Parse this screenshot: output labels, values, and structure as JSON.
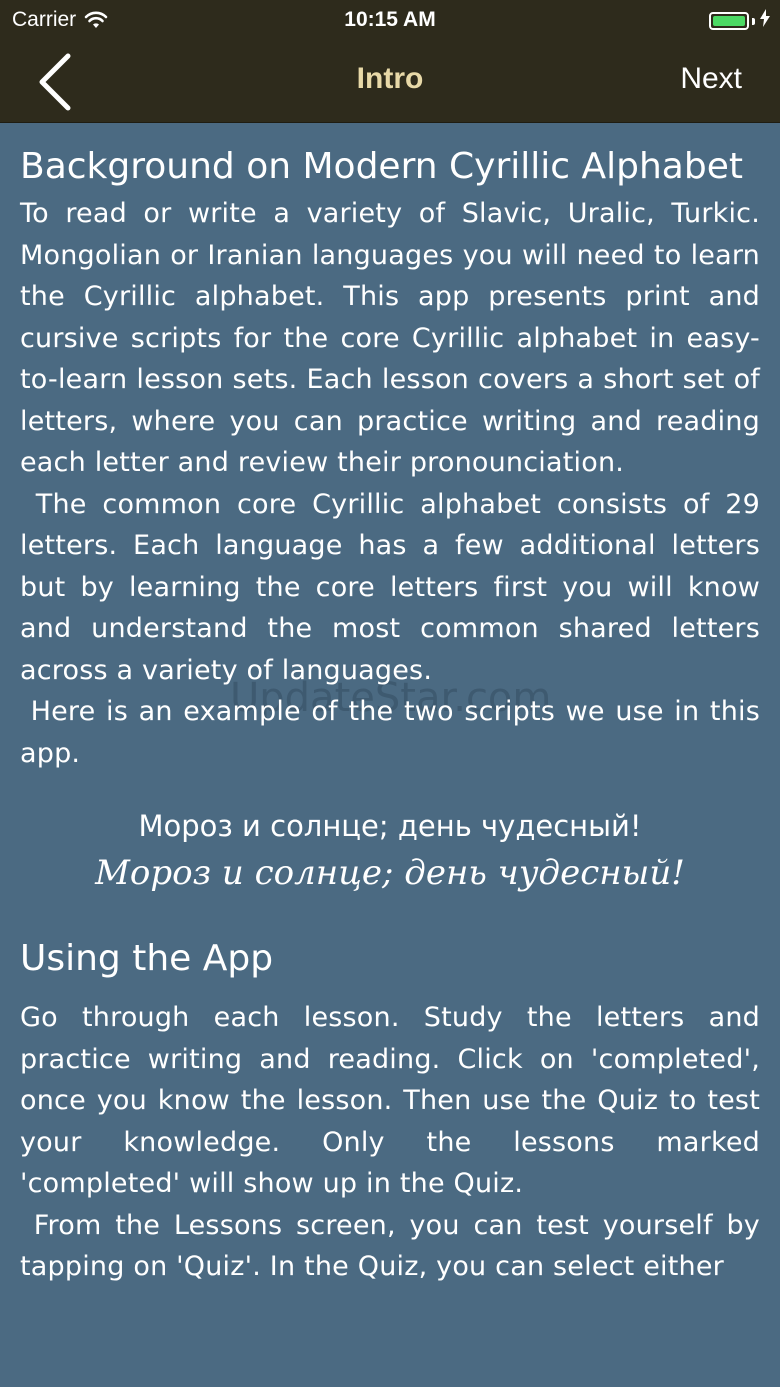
{
  "status": {
    "carrier": "Carrier",
    "time": "10:15 AM",
    "battery_level": 1.0,
    "battery_color": "#4cd964"
  },
  "nav": {
    "title": "Intro",
    "next_label": "Next",
    "back_icon": "chevron-left-icon"
  },
  "section1": {
    "title": "Background on Modern Cyrillic Alphabet",
    "paragraphs": [
      "To read or write a variety of Slavic, Uralic, Turkic. Mongolian or Iranian languages you will need to learn the Cyrillic alphabet. This app presents print and cursive scripts for the core Cyrillic alphabet in easy-to-learn lesson sets. Each lesson covers a short set of letters, where you can practice writing and reading each letter and review their pronounciation.",
      " The common core Cyrillic alphabet consists of 29 letters. Each language has a few additional letters but by learning the core letters first you will know and understand the most common shared letters across a variety of languages.",
      " Here is an example of the two scripts we use in this app."
    ]
  },
  "example": {
    "print": "Мороз и солнце; день чудесный!",
    "cursive": "Мороз и солнце; день чудесный!"
  },
  "section2": {
    "title": "Using the App",
    "paragraphs": [
      "Go through each lesson. Study the letters and practice writing and reading. Click on 'completed', once you know the lesson. Then use the Quiz to test your knowledge. Only the lessons marked 'completed' will show up in the Quiz.",
      " From the Lessons screen, you can test yourself by tapping on 'Quiz'. In the Quiz, you can select either"
    ]
  },
  "watermark": "UpdateStar.com",
  "colors": {
    "background": "#4b6a82",
    "navbar": "#2e2b1c",
    "title_accent": "#e8d9a8"
  }
}
